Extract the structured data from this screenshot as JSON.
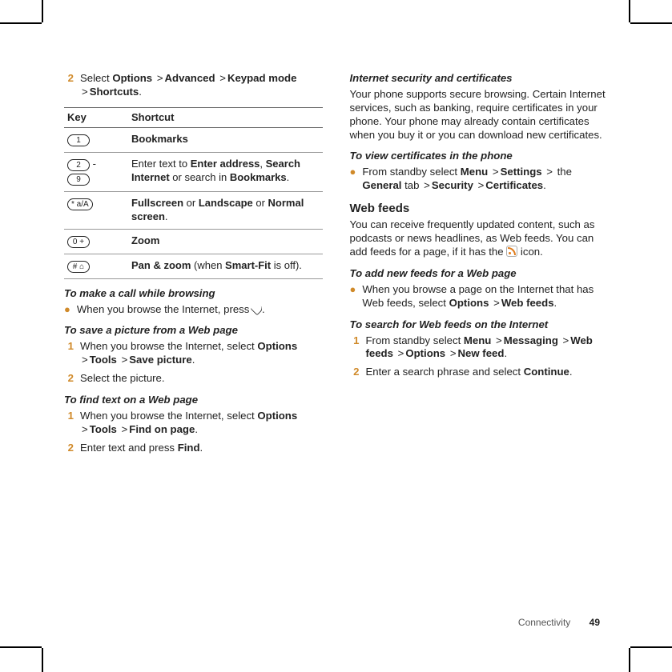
{
  "left": {
    "step2_num": "2",
    "step2_a": "Select ",
    "step2_b": "Options",
    "step2_c": "Advanced",
    "step2_d": "Keypad mode",
    "step2_e": "Shortcuts",
    "gt": ">",
    "period": ".",
    "table": {
      "h1": "Key",
      "h2": "Shortcut",
      "k1": "1",
      "v1": "Bookmarks",
      "k2a": "2",
      "k2dash": " - ",
      "k2b": "9",
      "v2a": "Enter text to ",
      "v2b": "Enter address",
      "v2c": ", ",
      "v2d": "Search Internet",
      "v2e": " or search in ",
      "v2f": "Bookmarks",
      "k3": "* a/A",
      "v3a": "Fullscreen",
      "v3b": " or ",
      "v3c": "Landscape",
      "v3d": " or ",
      "v3e": "Normal screen",
      "k4": "0 +",
      "v4": "Zoom",
      "k5": "# ⌂",
      "v5a": "Pan & zoom",
      "v5b": " (when ",
      "v5c": "Smart-Fit",
      "v5d": " is off)."
    },
    "call_head": "To make a call while browsing",
    "call_text": "When you browse the Internet, press ",
    "save_head": "To save a picture from a Web page",
    "save1_num": "1",
    "save1_a": "When you browse the Internet, select ",
    "save1_b": "Options",
    "save1_c": "Tools",
    "save1_d": "Save picture",
    "save2_num": "2",
    "save2_text": "Select the picture.",
    "find_head": "To find text on a Web page",
    "find1_num": "1",
    "find1_a": "When you browse the Internet, select ",
    "find1_b": "Options",
    "find1_c": "Tools",
    "find1_d": "Find on page",
    "find2_num": "2",
    "find2_a": "Enter text and press ",
    "find2_b": "Find"
  },
  "right": {
    "sec_head": "Internet security and certificates",
    "sec_p": "Your phone supports secure browsing. Certain Internet services, such as banking, require certificates in your phone. Your phone may already contain certificates when you buy it or you can download new certificates.",
    "cert_head": "To view certificates in the phone",
    "cert_a": "From standby select ",
    "cert_b": "Menu",
    "cert_c": "Settings",
    "cert_d": " the ",
    "cert_e": "General",
    "cert_f": " tab ",
    "cert_g": "Security",
    "cert_h": "Certificates",
    "feeds_title": "Web feeds",
    "feeds_p1": "You can receive frequently updated content, such as podcasts or news headlines, as Web feeds. You can add feeds for a page, if it has the ",
    "feeds_p2": " icon.",
    "add_head": "To add new feeds for a Web page",
    "add_a": "When you browse a page on the Internet that has Web feeds, select ",
    "add_b": "Options",
    "add_c": "Web feeds",
    "search_head": "To search for Web feeds on the Internet",
    "s1_num": "1",
    "s1_a": "From standby select ",
    "s1_b": "Menu",
    "s1_c": "Messaging",
    "s1_d": "Web feeds",
    "s1_e": "Options",
    "s1_f": "New feed",
    "s2_num": "2",
    "s2_a": "Enter a search phrase and select ",
    "s2_b": "Continue"
  },
  "footer": {
    "section": "Connectivity",
    "page": "49"
  }
}
